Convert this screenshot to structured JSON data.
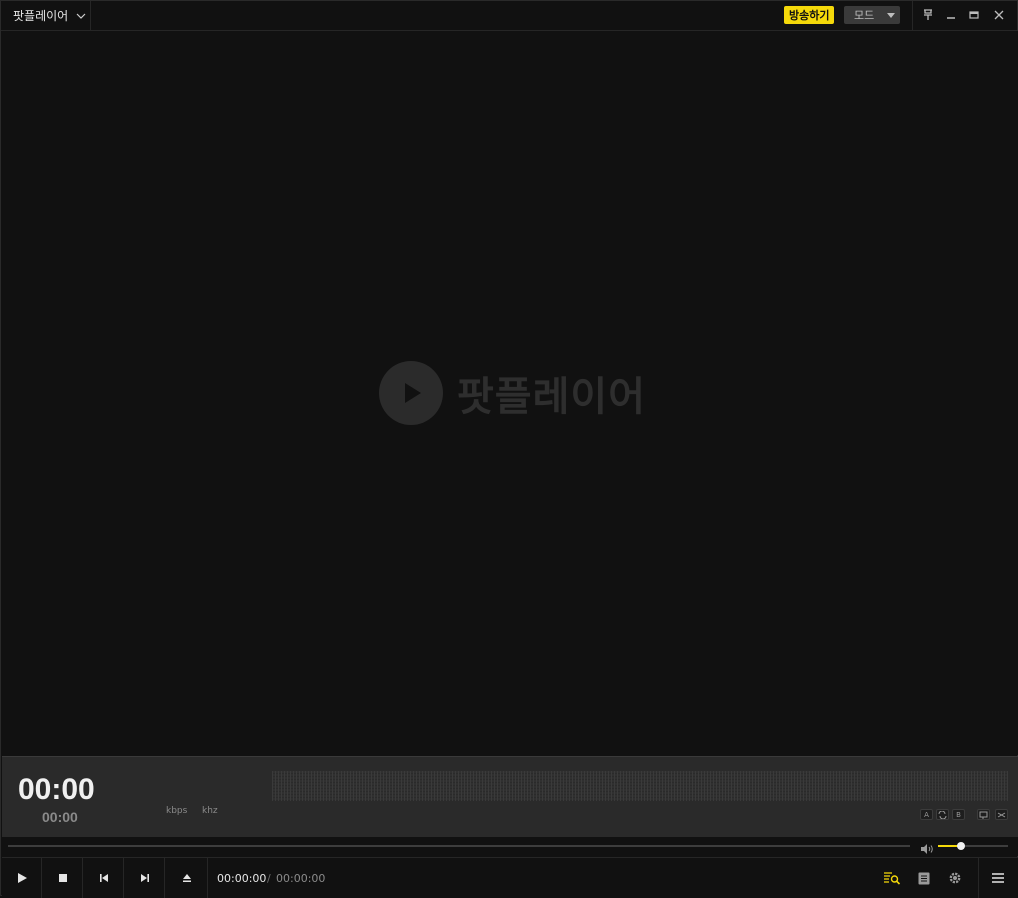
{
  "titlebar": {
    "app_name": "팟플레이어",
    "broadcast_label": "방송하기",
    "mode_label": "모드"
  },
  "video": {
    "logo_text": "팟플레이어"
  },
  "info": {
    "elapsed_big": "00:00",
    "elapsed_small": "00:00",
    "kbps_label": "kbps",
    "khz_label": "khz",
    "ab_a": "A",
    "ab_b": "B"
  },
  "volume": {
    "level_percent": 33
  },
  "controls": {
    "current_time": "00:00:00",
    "separator": "/",
    "total_time": "00:00:00"
  },
  "colors": {
    "accent": "#f5d90a",
    "background": "#111111",
    "panel": "#2a2a2a"
  }
}
